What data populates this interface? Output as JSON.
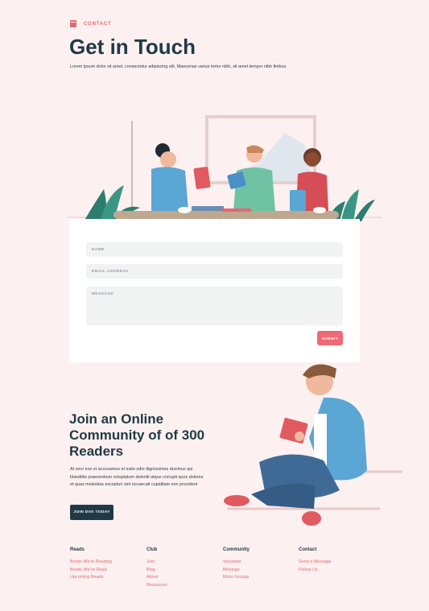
{
  "header": {
    "kicker": "CONTACT",
    "title": "Get in Touch",
    "intro": "Lorem ipsum dolor sit amet, consectetur adipiscing elit. Maecenas varius tortor nibh, sit amet tempor nibh finibus."
  },
  "form": {
    "name_placeholder": "NAME",
    "email_placeholder": "EMAIL ADDRESS",
    "message_placeholder": "MESSAGE",
    "submit_label": "SUBMIT"
  },
  "community": {
    "title": "Join an Online Community of of 300 Readers",
    "text": "At vero eos et accusamus et iusto odio dignissimos ducimus qui blanditiis praesentium voluptatum deleniti atque corrupti quos dolores et quas molestias excepturi sint occaecati cupiditate non provident",
    "cta_label": "JOIN DIVI TODAY"
  },
  "footer": {
    "columns": [
      {
        "heading": "Reads",
        "links": [
          "Books We're Reading",
          "Books We've Read",
          "Upcoming Reads"
        ]
      },
      {
        "heading": "Club",
        "links": [
          "Join",
          "Blog",
          "About",
          "Resources"
        ]
      },
      {
        "heading": "Community",
        "links": [
          "Volunteer",
          "Meetups",
          "Micro Groups"
        ]
      },
      {
        "heading": "Contact",
        "links": [
          "Send a Message",
          "Follow Us"
        ]
      }
    ]
  },
  "colors": {
    "background": "#fdf0f0",
    "primary_text": "#1f3a45",
    "accent": "#e06a72",
    "button": "#f06a75"
  },
  "icons": {
    "kicker": "book-icon"
  }
}
